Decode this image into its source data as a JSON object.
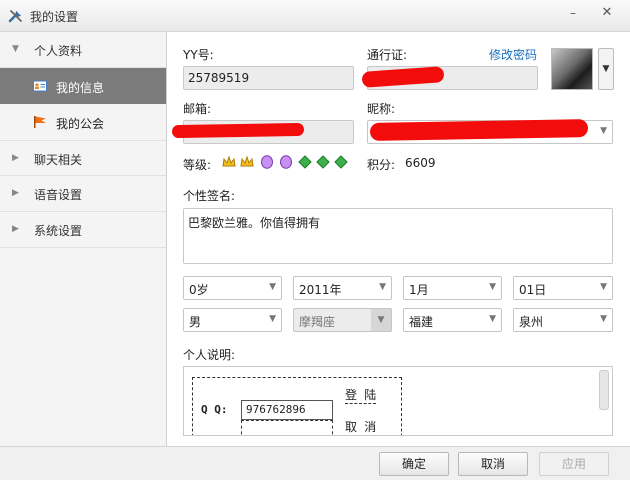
{
  "window": {
    "title": "我的设置",
    "minimize": "–",
    "close": "✕"
  },
  "sidebar": {
    "groups": [
      {
        "label": "个人资料",
        "expanded": true
      },
      {
        "label": "聊天相关",
        "expanded": false
      },
      {
        "label": "语音设置",
        "expanded": false
      },
      {
        "label": "系统设置",
        "expanded": false
      }
    ],
    "sub_items": [
      {
        "label": "我的信息",
        "active": true,
        "icon": "id-card-icon"
      },
      {
        "label": "我的公会",
        "active": false,
        "icon": "flag-icon"
      }
    ]
  },
  "profile": {
    "yy_label": "YY号:",
    "yy_value": "25789519",
    "passport_label": "通行证:",
    "change_password": "修改密码",
    "email_label": "邮箱:",
    "nickname_label": "昵称:",
    "level_label": "等级:",
    "points_label": "积分:",
    "points_value": "6609",
    "level_badges": [
      "crown-icon",
      "crown-icon",
      "moon-badge-icon",
      "moon-badge-icon",
      "diamond-icon",
      "diamond-icon",
      "diamond-icon"
    ],
    "signature_label": "个性签名:",
    "signature_value": "巴黎欧兰雅。你值得拥有",
    "age": "0岁",
    "year": "2011年",
    "month": "1月",
    "day": "01日",
    "gender": "男",
    "zodiac": "摩羯座",
    "province": "福建",
    "city": "泉州",
    "description_label": "个人说明:",
    "description_art": {
      "qq_label": "Q Q:",
      "qq_value": "976762896",
      "login": "登 陆",
      "cancel": "取 消"
    }
  },
  "buttons": {
    "ok": "确定",
    "cancel": "取消",
    "apply": "应用"
  },
  "colors": {
    "redaction": "#f20c0c",
    "link": "#1a6fc0",
    "active_nav": "#7b7b7b"
  }
}
